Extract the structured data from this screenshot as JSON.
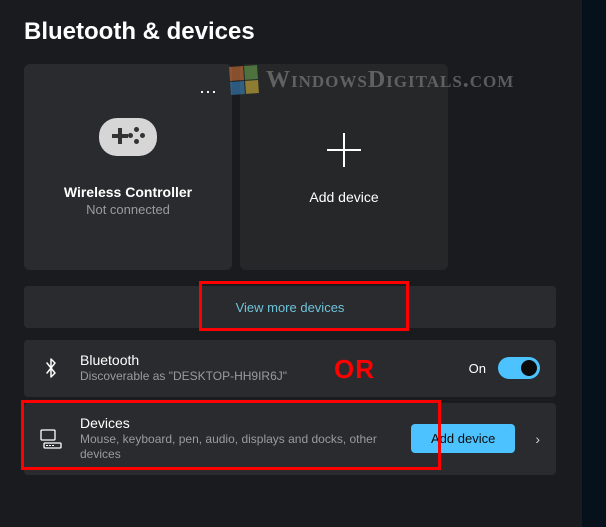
{
  "page": {
    "title": "Bluetooth & devices"
  },
  "tiles": {
    "device": {
      "name": "Wireless Controller",
      "status": "Not connected",
      "menu": "⋯"
    },
    "add_device": {
      "label": "Add device"
    }
  },
  "view_more": {
    "label": "View more devices"
  },
  "bluetooth_row": {
    "title": "Bluetooth",
    "subtitle": "Discoverable as \"DESKTOP-HH9IR6J\"",
    "state_label": "On"
  },
  "devices_row": {
    "title": "Devices",
    "subtitle": "Mouse, keyboard, pen, audio, displays and docks, other devices",
    "button": "Add device",
    "chevron": "›"
  },
  "annotations": {
    "or": "OR"
  },
  "watermark": {
    "text": "WindowsDigitals.com"
  }
}
